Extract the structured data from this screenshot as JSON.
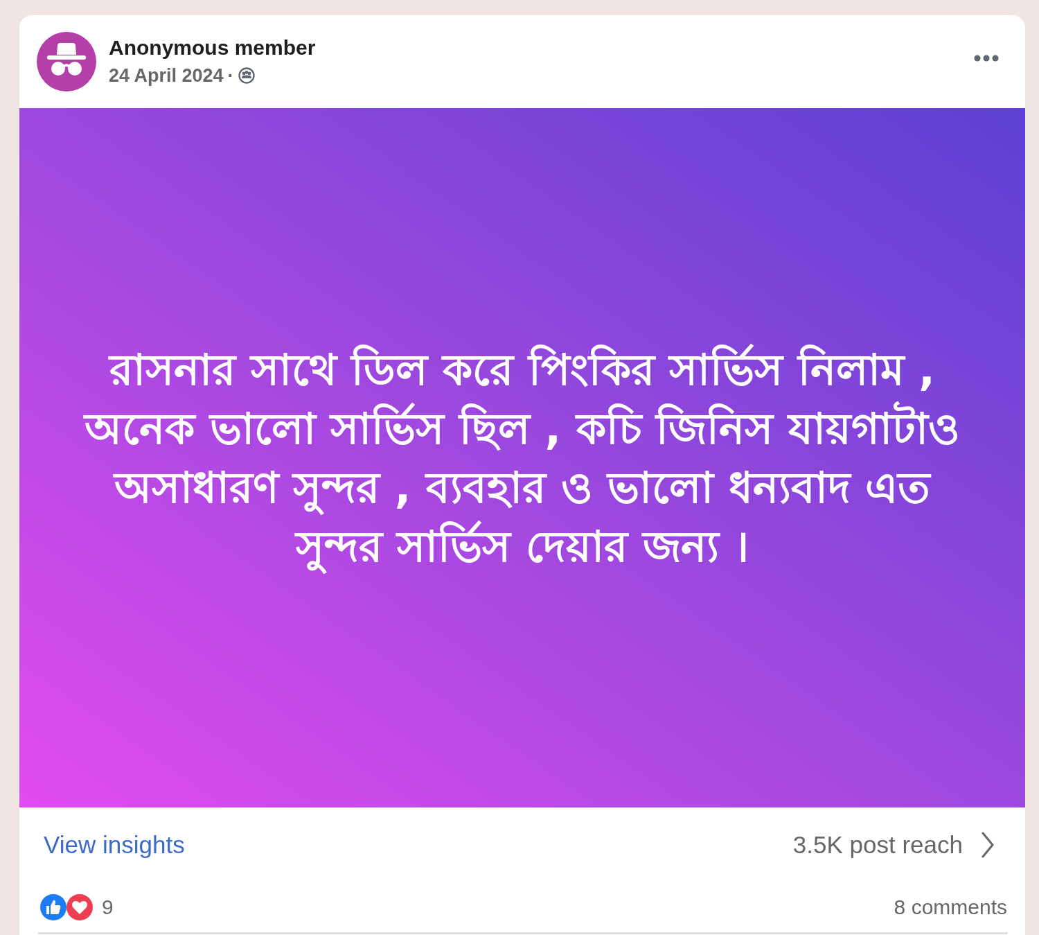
{
  "post": {
    "author": "Anonymous member",
    "date": "24 April 2024",
    "separator": "·",
    "text": "রাসনার সাথে ডিল করে পিংকির সার্ভিস নিলাম , অনেক ভালো সার্ভিস ছিল , কচি জিনিস যায়গাটাও অসাধারণ সুন্দর , ব্যবহার ও ভালো ধন্যবাদ এত সুন্দর সার্ভিস দেয়ার জন্য ।",
    "insights_link": "View insights",
    "reach": "3.5K post reach",
    "reactions": [
      {
        "kind": "like"
      },
      {
        "kind": "love"
      }
    ],
    "reaction_count": "9",
    "comments": "8 comments"
  }
}
